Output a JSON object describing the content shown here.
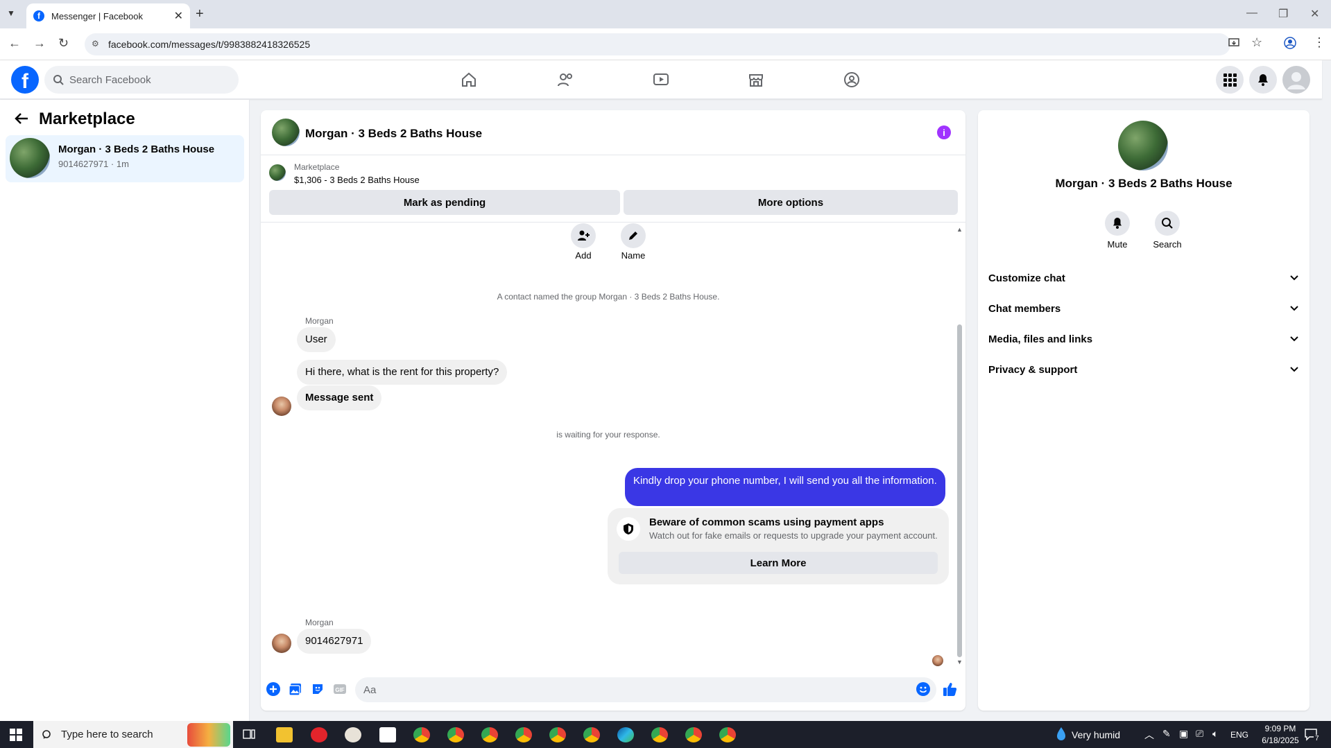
{
  "browser": {
    "tab_title": "Messenger | Facebook",
    "url": "facebook.com/messages/t/9983882418326525"
  },
  "fb": {
    "logo": "f",
    "search_placeholder": "Search Facebook",
    "nav_icons": [
      "home-icon",
      "friends-icon",
      "watch-icon",
      "marketplace-icon",
      "groups-icon"
    ],
    "brand_color": "#0866ff"
  },
  "sidebar": {
    "title": "Marketplace",
    "chat": {
      "name": "Morgan · 3 Beds 2 Baths House",
      "sub": "9014627971 · 1m"
    }
  },
  "chat": {
    "title": "Morgan · 3 Beds 2 Baths House",
    "listing_label": "Marketplace",
    "listing_price": "$1,306 - 3 Beds 2 Baths House",
    "mark_pending": "Mark as pending",
    "more_options": "More options",
    "add_label": "Add",
    "name_label": "Name",
    "system_rename": "A contact named the group Morgan · 3 Beds 2 Baths House.",
    "sender_1": "Morgan",
    "msg_user": "User",
    "msg_rent": "Hi there, what is the rent for this property?",
    "msg_sent": "Message sent",
    "system_waiting": "is waiting for your response.",
    "my_msg": "Kindly drop your phone number, I will send you all the information.",
    "scam_title": "Beware of common scams using payment apps",
    "scam_text": "Watch out for fake emails or requests to upgrade your payment account.",
    "learn_more": "Learn More",
    "sender_2": "Morgan",
    "msg_phone": "9014627971",
    "composer_placeholder": "Aa",
    "my_bubble_color": "#3a37e5"
  },
  "details": {
    "name": "Morgan · 3 Beds 2 Baths House",
    "mute": "Mute",
    "search": "Search",
    "rows": [
      "Customize chat",
      "Chat members",
      "Media, files and links",
      "Privacy & support"
    ]
  },
  "taskbar": {
    "search_placeholder": "Type here to search",
    "weather": "Very humid",
    "lang": "ENG",
    "time": "9:09 PM",
    "date": "6/18/2025",
    "notif_count": "7"
  }
}
